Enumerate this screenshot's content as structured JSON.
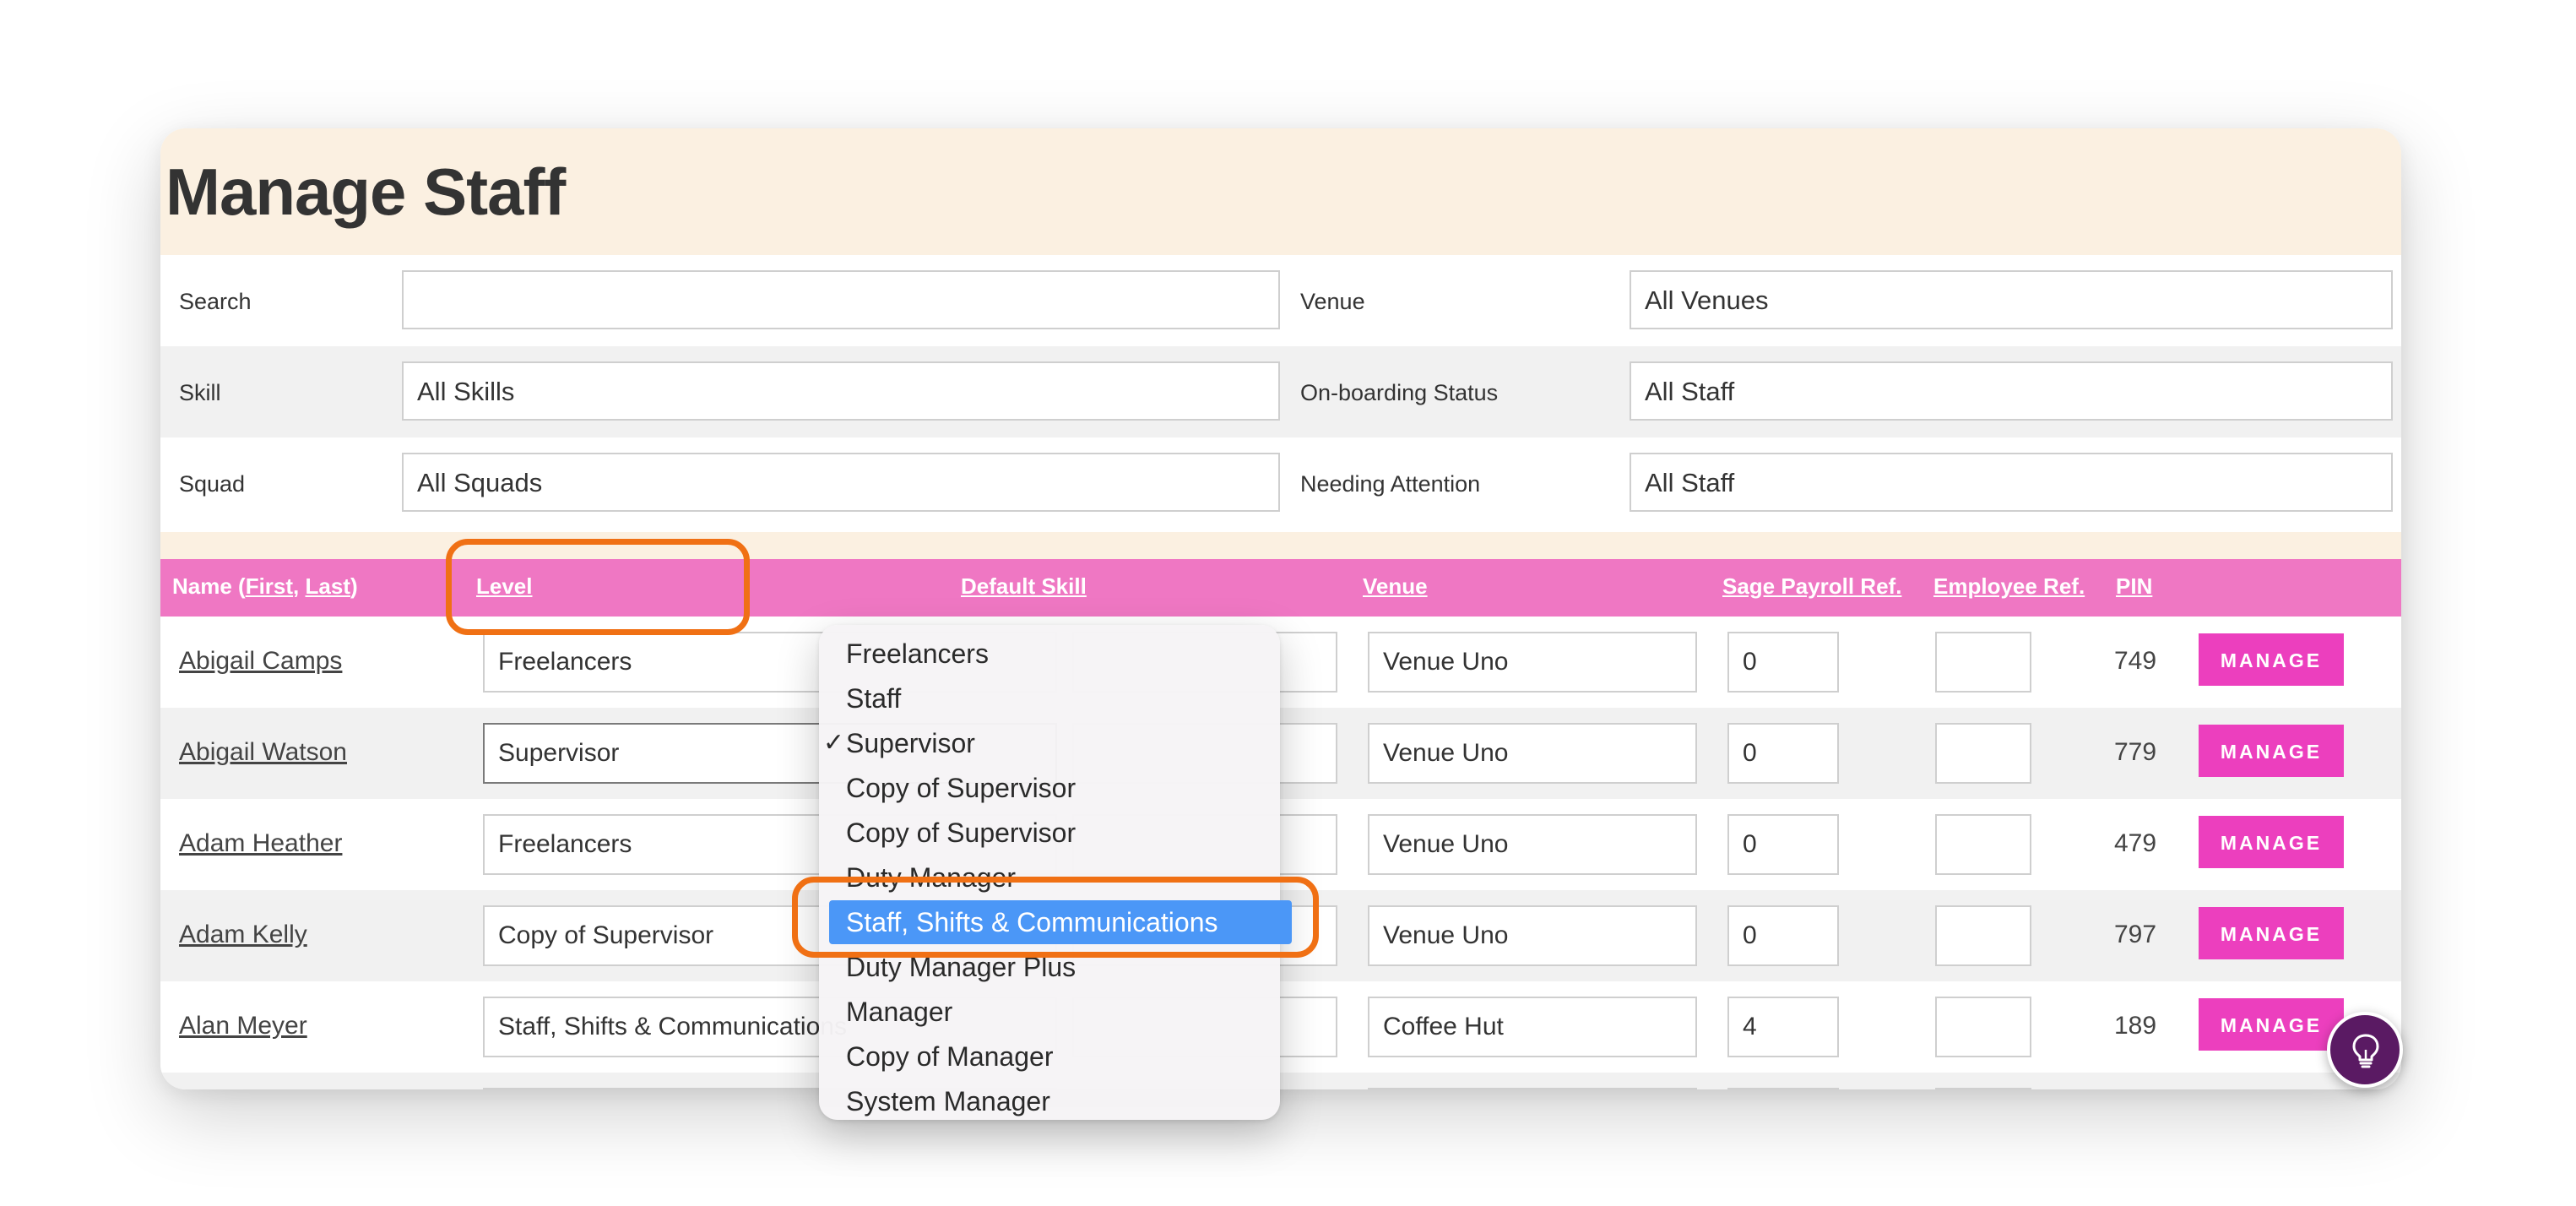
{
  "page": {
    "title": "Manage Staff"
  },
  "filters": {
    "search": {
      "label": "Search",
      "value": ""
    },
    "venue": {
      "label": "Venue",
      "value": "All Venues"
    },
    "skill": {
      "label": "Skill",
      "value": "All Skills"
    },
    "onboarding": {
      "label": "On-boarding Status",
      "value": "All Staff"
    },
    "squad": {
      "label": "Squad",
      "value": "All Squads"
    },
    "attention": {
      "label": "Needing Attention",
      "value": "All Staff"
    }
  },
  "table": {
    "headers": {
      "name_prefix": "Name (",
      "first": "First",
      "comma": ", ",
      "last": "Last",
      "name_suffix": ")",
      "level": "Level",
      "default_skill": "Default Skill",
      "venue": "Venue",
      "sage": "Sage Payroll Ref.",
      "employee": "Employee Ref.",
      "pin": "PIN"
    },
    "manage_label": "MANAGE",
    "rows": [
      {
        "name": "Abigail Camps",
        "level": "Freelancers",
        "venue": "Venue Uno",
        "sage": "0",
        "employee": "",
        "pin": "749"
      },
      {
        "name": "Abigail Watson",
        "level": "Supervisor",
        "venue": "Venue Uno",
        "sage": "0",
        "employee": "",
        "pin": "779"
      },
      {
        "name": "Adam Heather",
        "level": "Freelancers",
        "venue": "Venue Uno",
        "sage": "0",
        "employee": "",
        "pin": "479"
      },
      {
        "name": "Adam Kelly",
        "level": "Copy of Supervisor",
        "venue": "Venue Uno",
        "sage": "0",
        "employee": "",
        "pin": "797"
      },
      {
        "name": "Alan Meyer",
        "level": "Staff, Shifts & Communications",
        "venue": "Coffee Hut",
        "sage": "4",
        "employee": "",
        "pin": "189"
      }
    ]
  },
  "dropdown": {
    "check_mark": "✓",
    "options": [
      "Freelancers",
      "Staff",
      "Supervisor",
      "Copy of Supervisor",
      "Copy of Supervisor",
      "Duty Manager",
      "Staff, Shifts & Communications",
      "Duty Manager Plus",
      "Manager",
      "Copy of Manager",
      "System Manager"
    ],
    "selected": "Supervisor",
    "highlighted": "Staff, Shifts & Communications"
  },
  "help_button": {
    "icon": "lightbulb-icon"
  },
  "colors": {
    "title_band": "#fbf0e1",
    "table_header": "#ef77c3",
    "manage_button": "#ec3fbe",
    "highlight": "#4b97f7",
    "callout": "#f07014",
    "help_button": "#5a1a63"
  }
}
